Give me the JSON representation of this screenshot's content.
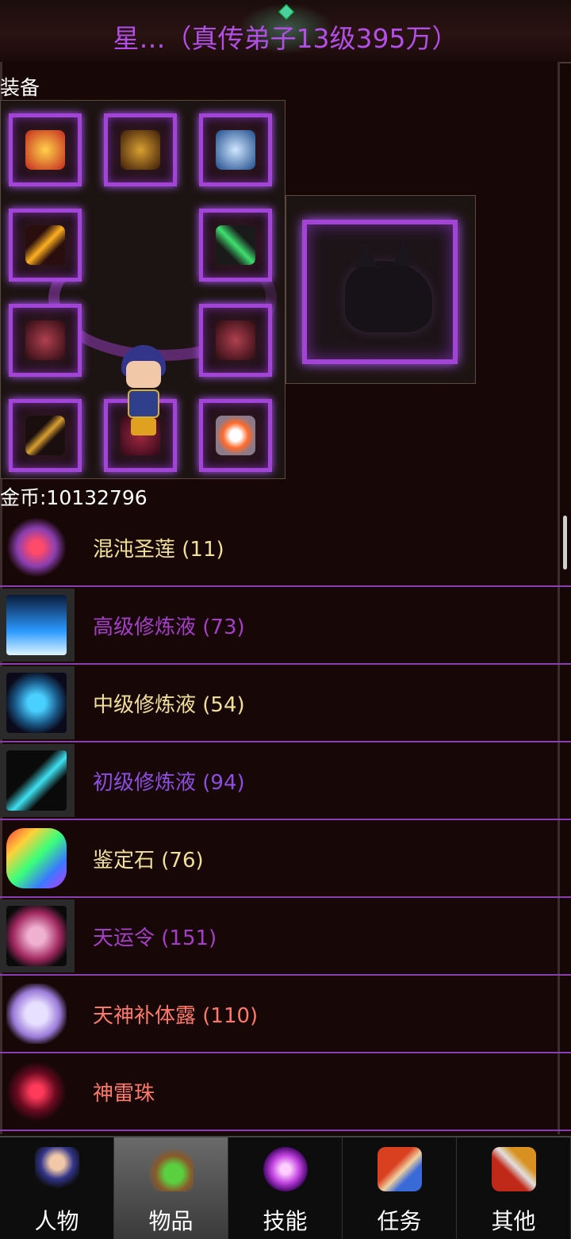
{
  "header": {
    "title": "星…（真传弟子13级395万）"
  },
  "equipment": {
    "label": "装备"
  },
  "gold": {
    "text": "金币:10132796"
  },
  "items": [
    {
      "name": "混沌圣莲 (11)",
      "color": "#f0e09a",
      "icon": "chaos-lotus-icon",
      "framed": false
    },
    {
      "name": "高级修炼液 (73)",
      "color": "#a63fc8",
      "icon": "advanced-elixir-icon",
      "framed": true
    },
    {
      "name": "中级修炼液 (54)",
      "color": "#f0e09a",
      "icon": "intermediate-elixir-icon",
      "framed": true
    },
    {
      "name": "初级修炼液 (94)",
      "color": "#8c4fe0",
      "icon": "basic-elixir-icon",
      "framed": true
    },
    {
      "name": "鉴定石 (76)",
      "color": "#f0e09a",
      "icon": "appraisal-stone-icon",
      "framed": false
    },
    {
      "name": "天运令 (151)",
      "color": "#a63fc8",
      "icon": "fortune-token-icon",
      "framed": true
    },
    {
      "name": "天神补体露 (110)",
      "color": "#ff7a6a",
      "icon": "divine-dew-icon",
      "framed": false
    },
    {
      "name": "神雷珠",
      "color": "#ff7a6a",
      "icon": "thunder-orb-icon",
      "framed": false
    }
  ],
  "nav": {
    "tabs": [
      {
        "label": "人物",
        "icon": "character-icon",
        "active": false
      },
      {
        "label": "物品",
        "icon": "items-potion-icon",
        "active": true
      },
      {
        "label": "技能",
        "icon": "skills-orb-icon",
        "active": false
      },
      {
        "label": "任务",
        "icon": "quests-icon",
        "active": false
      },
      {
        "label": "其他",
        "icon": "other-icon",
        "active": false
      }
    ]
  },
  "colors": {
    "title": "#b24fe6",
    "row_divider": "#8a3fb0",
    "slot_frame": "#a244d6",
    "item_yellow": "#f0e09a",
    "item_purple": "#a63fc8",
    "item_violet": "#8c4fe0",
    "item_red": "#ff7a6a"
  }
}
